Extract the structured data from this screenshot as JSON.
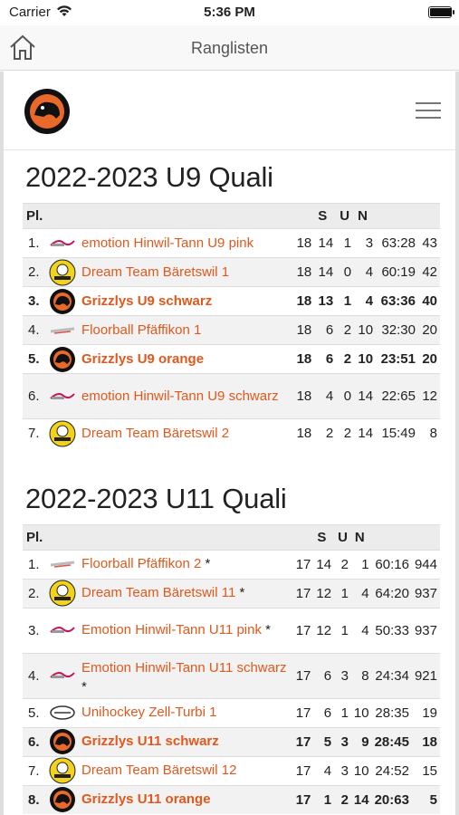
{
  "status": {
    "carrier": "Carrier",
    "time": "5:36 PM",
    "battery_level": 1.0
  },
  "nav": {
    "title": "Ranglisten",
    "home_icon": "home-icon"
  },
  "header": {
    "logo_icon": "grizzlys-logo-icon",
    "menu_icon": "hamburger-menu-icon"
  },
  "tables": [
    {
      "title": "2022-2023 U9 Quali",
      "columns": {
        "pl": "Pl.",
        "s": "S",
        "u": "U",
        "n": "N"
      },
      "rows": [
        {
          "pl": "1.",
          "team": "emotion Hinwil-Tann U9 pink",
          "logo": "emotion-logo",
          "gp": "18",
          "s": "14",
          "u": "1",
          "n": "3",
          "goals": "63:28",
          "pts": "43",
          "own": false,
          "tall": false
        },
        {
          "pl": "2.",
          "team": "Dream Team Bäretswil 1",
          "logo": "dreamteam-logo",
          "gp": "18",
          "s": "14",
          "u": "0",
          "n": "4",
          "goals": "60:19",
          "pts": "42",
          "own": false,
          "tall": false
        },
        {
          "pl": "3.",
          "team": "Grizzlys U9 schwarz",
          "logo": "grizzlys-logo",
          "gp": "18",
          "s": "13",
          "u": "1",
          "n": "4",
          "goals": "63:36",
          "pts": "40",
          "own": true,
          "tall": false
        },
        {
          "pl": "4.",
          "team": "Floorball Pfäffikon 1",
          "logo": "pfaeffikon-logo",
          "gp": "18",
          "s": "6",
          "u": "2",
          "n": "10",
          "goals": "32:30",
          "pts": "20",
          "own": false,
          "tall": false
        },
        {
          "pl": "5.",
          "team": "Grizzlys U9 orange",
          "logo": "grizzlys-logo",
          "gp": "18",
          "s": "6",
          "u": "2",
          "n": "10",
          "goals": "23:51",
          "pts": "20",
          "own": true,
          "tall": false
        },
        {
          "pl": "6.",
          "team": "emotion Hinwil-Tann U9 schwarz",
          "logo": "emotion-logo",
          "gp": "18",
          "s": "4",
          "u": "0",
          "n": "14",
          "goals": "22:65",
          "pts": "12",
          "own": false,
          "tall": true
        },
        {
          "pl": "7.",
          "team": "Dream Team Bäretswil 2",
          "logo": "dreamteam-logo",
          "gp": "18",
          "s": "2",
          "u": "2",
          "n": "14",
          "goals": "15:49",
          "pts": "8",
          "own": false,
          "tall": false
        }
      ]
    },
    {
      "title": "2022-2023 U11 Quali",
      "columns": {
        "pl": "Pl.",
        "s": "S",
        "u": "U",
        "n": "N"
      },
      "rows": [
        {
          "pl": "1.",
          "team": "Floorball Pfäffikon 2",
          "star": "*",
          "logo": "pfaeffikon-logo",
          "gp": "17",
          "s": "14",
          "u": "2",
          "n": "1",
          "goals": "60:16",
          "pts": "944",
          "own": false,
          "tall": false
        },
        {
          "pl": "2.",
          "team": "Dream Team Bäretswil 11",
          "star": "*",
          "logo": "dreamteam-logo",
          "gp": "17",
          "s": "12",
          "u": "1",
          "n": "4",
          "goals": "64:20",
          "pts": "937",
          "own": false,
          "tall": false
        },
        {
          "pl": "3.",
          "team": "Emotion Hinwil-Tann U11 pink",
          "star": "*",
          "logo": "emotion-logo",
          "gp": "17",
          "s": "12",
          "u": "1",
          "n": "4",
          "goals": "50:33",
          "pts": "937",
          "own": false,
          "tall": true
        },
        {
          "pl": "4.",
          "team": "Emotion Hinwil-Tann U11 schwarz",
          "star": "*",
          "logo": "emotion-logo",
          "gp": "17",
          "s": "6",
          "u": "3",
          "n": "8",
          "goals": "24:34",
          "pts": "921",
          "own": false,
          "tall": true
        },
        {
          "pl": "5.",
          "team": "Unihockey Zell-Turbi 1",
          "logo": "zell-logo",
          "gp": "17",
          "s": "6",
          "u": "1",
          "n": "10",
          "goals": "28:35",
          "pts": "19",
          "own": false,
          "tall": false
        },
        {
          "pl": "6.",
          "team": "Grizzlys U11 schwarz",
          "logo": "grizzlys-logo",
          "gp": "17",
          "s": "5",
          "u": "3",
          "n": "9",
          "goals": "28:45",
          "pts": "18",
          "own": true,
          "tall": false
        },
        {
          "pl": "7.",
          "team": "Dream Team Bäretswil 12",
          "logo": "dreamteam-logo",
          "gp": "17",
          "s": "4",
          "u": "3",
          "n": "10",
          "goals": "24:52",
          "pts": "15",
          "own": false,
          "tall": false
        },
        {
          "pl": "8.",
          "team": "Grizzlys U11 orange",
          "logo": "grizzlys-logo",
          "gp": "17",
          "s": "1",
          "u": "2",
          "n": "14",
          "goals": "20:63",
          "pts": "5",
          "own": true,
          "tall": false
        }
      ]
    }
  ],
  "colors": {
    "link": "#e2581c",
    "header_bg": "#ececec",
    "stripe": "#f2f2f2",
    "logo_orange": "#e8692a",
    "logo_yellow": "#f3d21c"
  }
}
